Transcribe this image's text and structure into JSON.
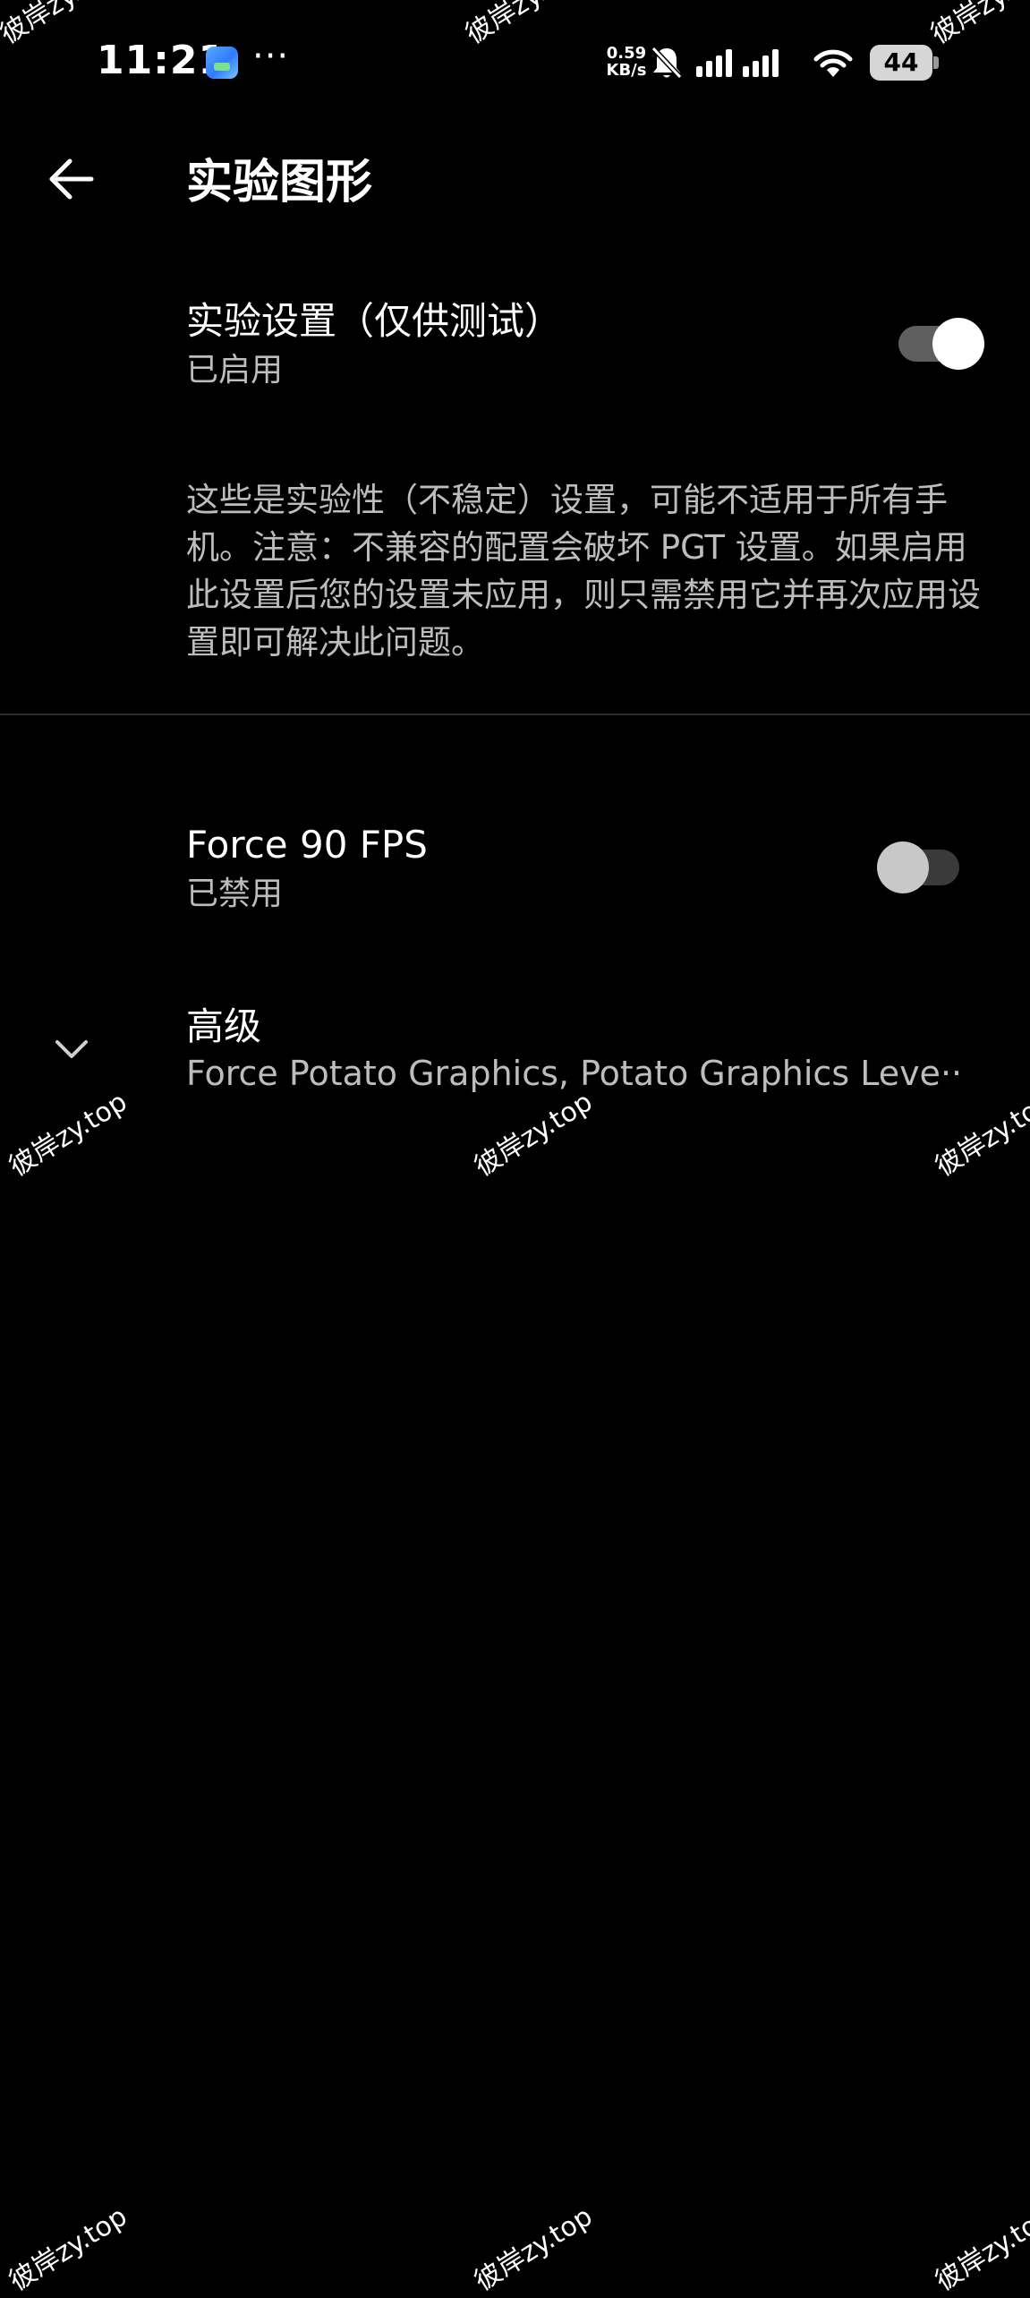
{
  "status_bar": {
    "time": "11:21",
    "more": "···",
    "net_speed_value": "0.59",
    "net_speed_unit": "KB/s",
    "battery": "44",
    "icons": [
      "gallery-app-icon",
      "mute-bell-icon",
      "cellular-signal-icon",
      "wifi-icon",
      "battery-icon"
    ]
  },
  "header": {
    "title": "实验图形",
    "back_icon": "arrow-left-icon"
  },
  "experimental": {
    "title": "实验设置（仅供测试）",
    "status": "已启用",
    "enabled": true,
    "description": "这些是实验性（不稳定）设置，可能不适用于所有手机。注意：不兼容的配置会破坏 PGT 设置。如果启用此设置后您的设置未应用，则只需禁用它并再次应用设置即可解决此问题。"
  },
  "force90": {
    "title": "Force 90 FPS",
    "status": "已禁用",
    "enabled": false
  },
  "advanced": {
    "title": "高级",
    "summary": "Force Potato Graphics, Potato Graphics Leve··",
    "icon": "chevron-down-icon"
  },
  "watermark": {
    "text": "彼岸zy.top"
  },
  "colors": {
    "background": "#000000",
    "text_primary": "#ffffff",
    "text_secondary": "#bdbdbd",
    "toggle_on_thumb": "#ffffff",
    "toggle_off_thumb": "#c8c8c8"
  }
}
